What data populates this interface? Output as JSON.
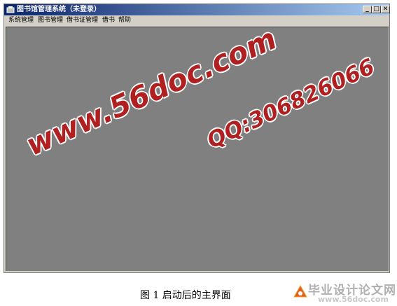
{
  "window": {
    "title": "图书馆管理系统（未登录）",
    "controls": {
      "minimize": "_",
      "maximize": "□",
      "close": "✕"
    }
  },
  "menu": {
    "items": [
      "系统管理",
      "图书管理",
      "借书证管理",
      "借书",
      "帮助"
    ]
  },
  "watermark": {
    "url": "www.56doc.com",
    "qq": "QQ:306826066"
  },
  "caption": "图 1  启动后的主界面",
  "logo": {
    "text": "毕业设计论文网",
    "url": "www.56doc.com"
  },
  "colors": {
    "titlebar_start": "#0a246a",
    "titlebar_end": "#a6caf0",
    "client_bg": "#808080",
    "chrome": "#d4d0c8",
    "watermark": "#b02020"
  }
}
